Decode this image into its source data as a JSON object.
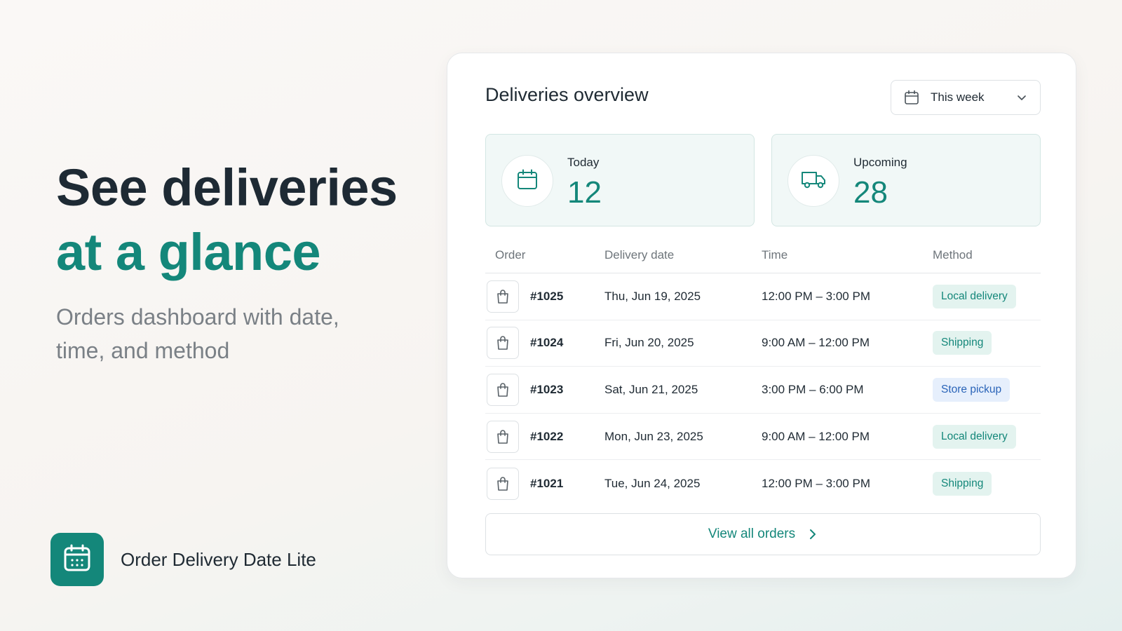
{
  "hero": {
    "line1": "See deliveries",
    "line2": "at a glance",
    "subtitle": "Orders dashboard with date, time, and method"
  },
  "brand": {
    "name": "Order Delivery Date Lite",
    "icon": "calendar-icon"
  },
  "card": {
    "title": "Deliveries overview",
    "range_select": {
      "value": "This week",
      "icon": "calendar-icon"
    },
    "stats": [
      {
        "label": "Today",
        "value": "12",
        "icon": "calendar-icon"
      },
      {
        "label": "Upcoming",
        "value": "28",
        "icon": "truck-icon"
      }
    ],
    "table": {
      "headers": [
        "Order",
        "Delivery date",
        "Time",
        "Method"
      ],
      "rows": [
        {
          "order": "#1025",
          "date": "Thu, Jun 19, 2025",
          "time": "12:00 PM – 3:00 PM",
          "method": "Local delivery"
        },
        {
          "order": "#1024",
          "date": "Fri, Jun 20, 2025",
          "time": "9:00 AM – 12:00 PM",
          "method": "Shipping"
        },
        {
          "order": "#1023",
          "date": "Sat, Jun 21, 2025",
          "time": "3:00 PM – 6:00 PM",
          "method": "Store pickup"
        },
        {
          "order": "#1022",
          "date": "Mon, Jun 23, 2025",
          "time": "9:00 AM – 12:00 PM",
          "method": "Local delivery"
        },
        {
          "order": "#1021",
          "date": "Tue, Jun 24, 2025",
          "time": "12:00 PM – 3:00 PM",
          "method": "Shipping"
        }
      ]
    },
    "view_all_label": "View all orders"
  },
  "colors": {
    "accent": "#14877a",
    "heading": "#1e2a34",
    "muted": "#7a8086",
    "badge_green_bg": "#e3f3ef",
    "badge_blue_bg": "#e6effc",
    "badge_blue_text": "#2a64b8"
  }
}
